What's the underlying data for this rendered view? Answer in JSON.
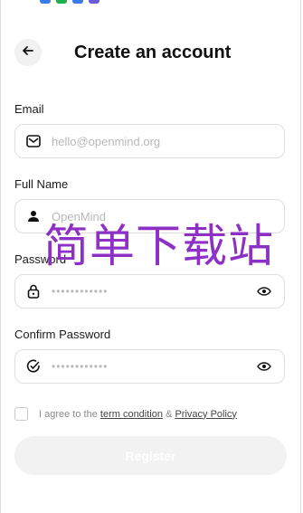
{
  "colors": {
    "accent": "#8e2fc6",
    "border": "#dedede",
    "muted": "#b9b9b9"
  },
  "header": {
    "title": "Create an account",
    "back_icon": "arrow-left-icon"
  },
  "form": {
    "email": {
      "label": "Email",
      "placeholder": "hello@openmind.org",
      "icon": "mail-icon"
    },
    "full_name": {
      "label": "Full Name",
      "placeholder": "OpenMind",
      "icon": "user-icon"
    },
    "password": {
      "label": "Password",
      "value": "••••••••••••",
      "icon": "lock-icon",
      "toggle_icon": "eye-icon"
    },
    "confirm_password": {
      "label": "Confirm Password",
      "value": "••••••••••••",
      "icon": "check-circle-icon",
      "toggle_icon": "eye-icon"
    }
  },
  "terms": {
    "prefix": "I agree to the",
    "term_link": "term condition",
    "amp": "&",
    "privacy_link": "Privacy Policy"
  },
  "register": {
    "label": "Register"
  },
  "watermark": {
    "text": "简单下载站"
  }
}
